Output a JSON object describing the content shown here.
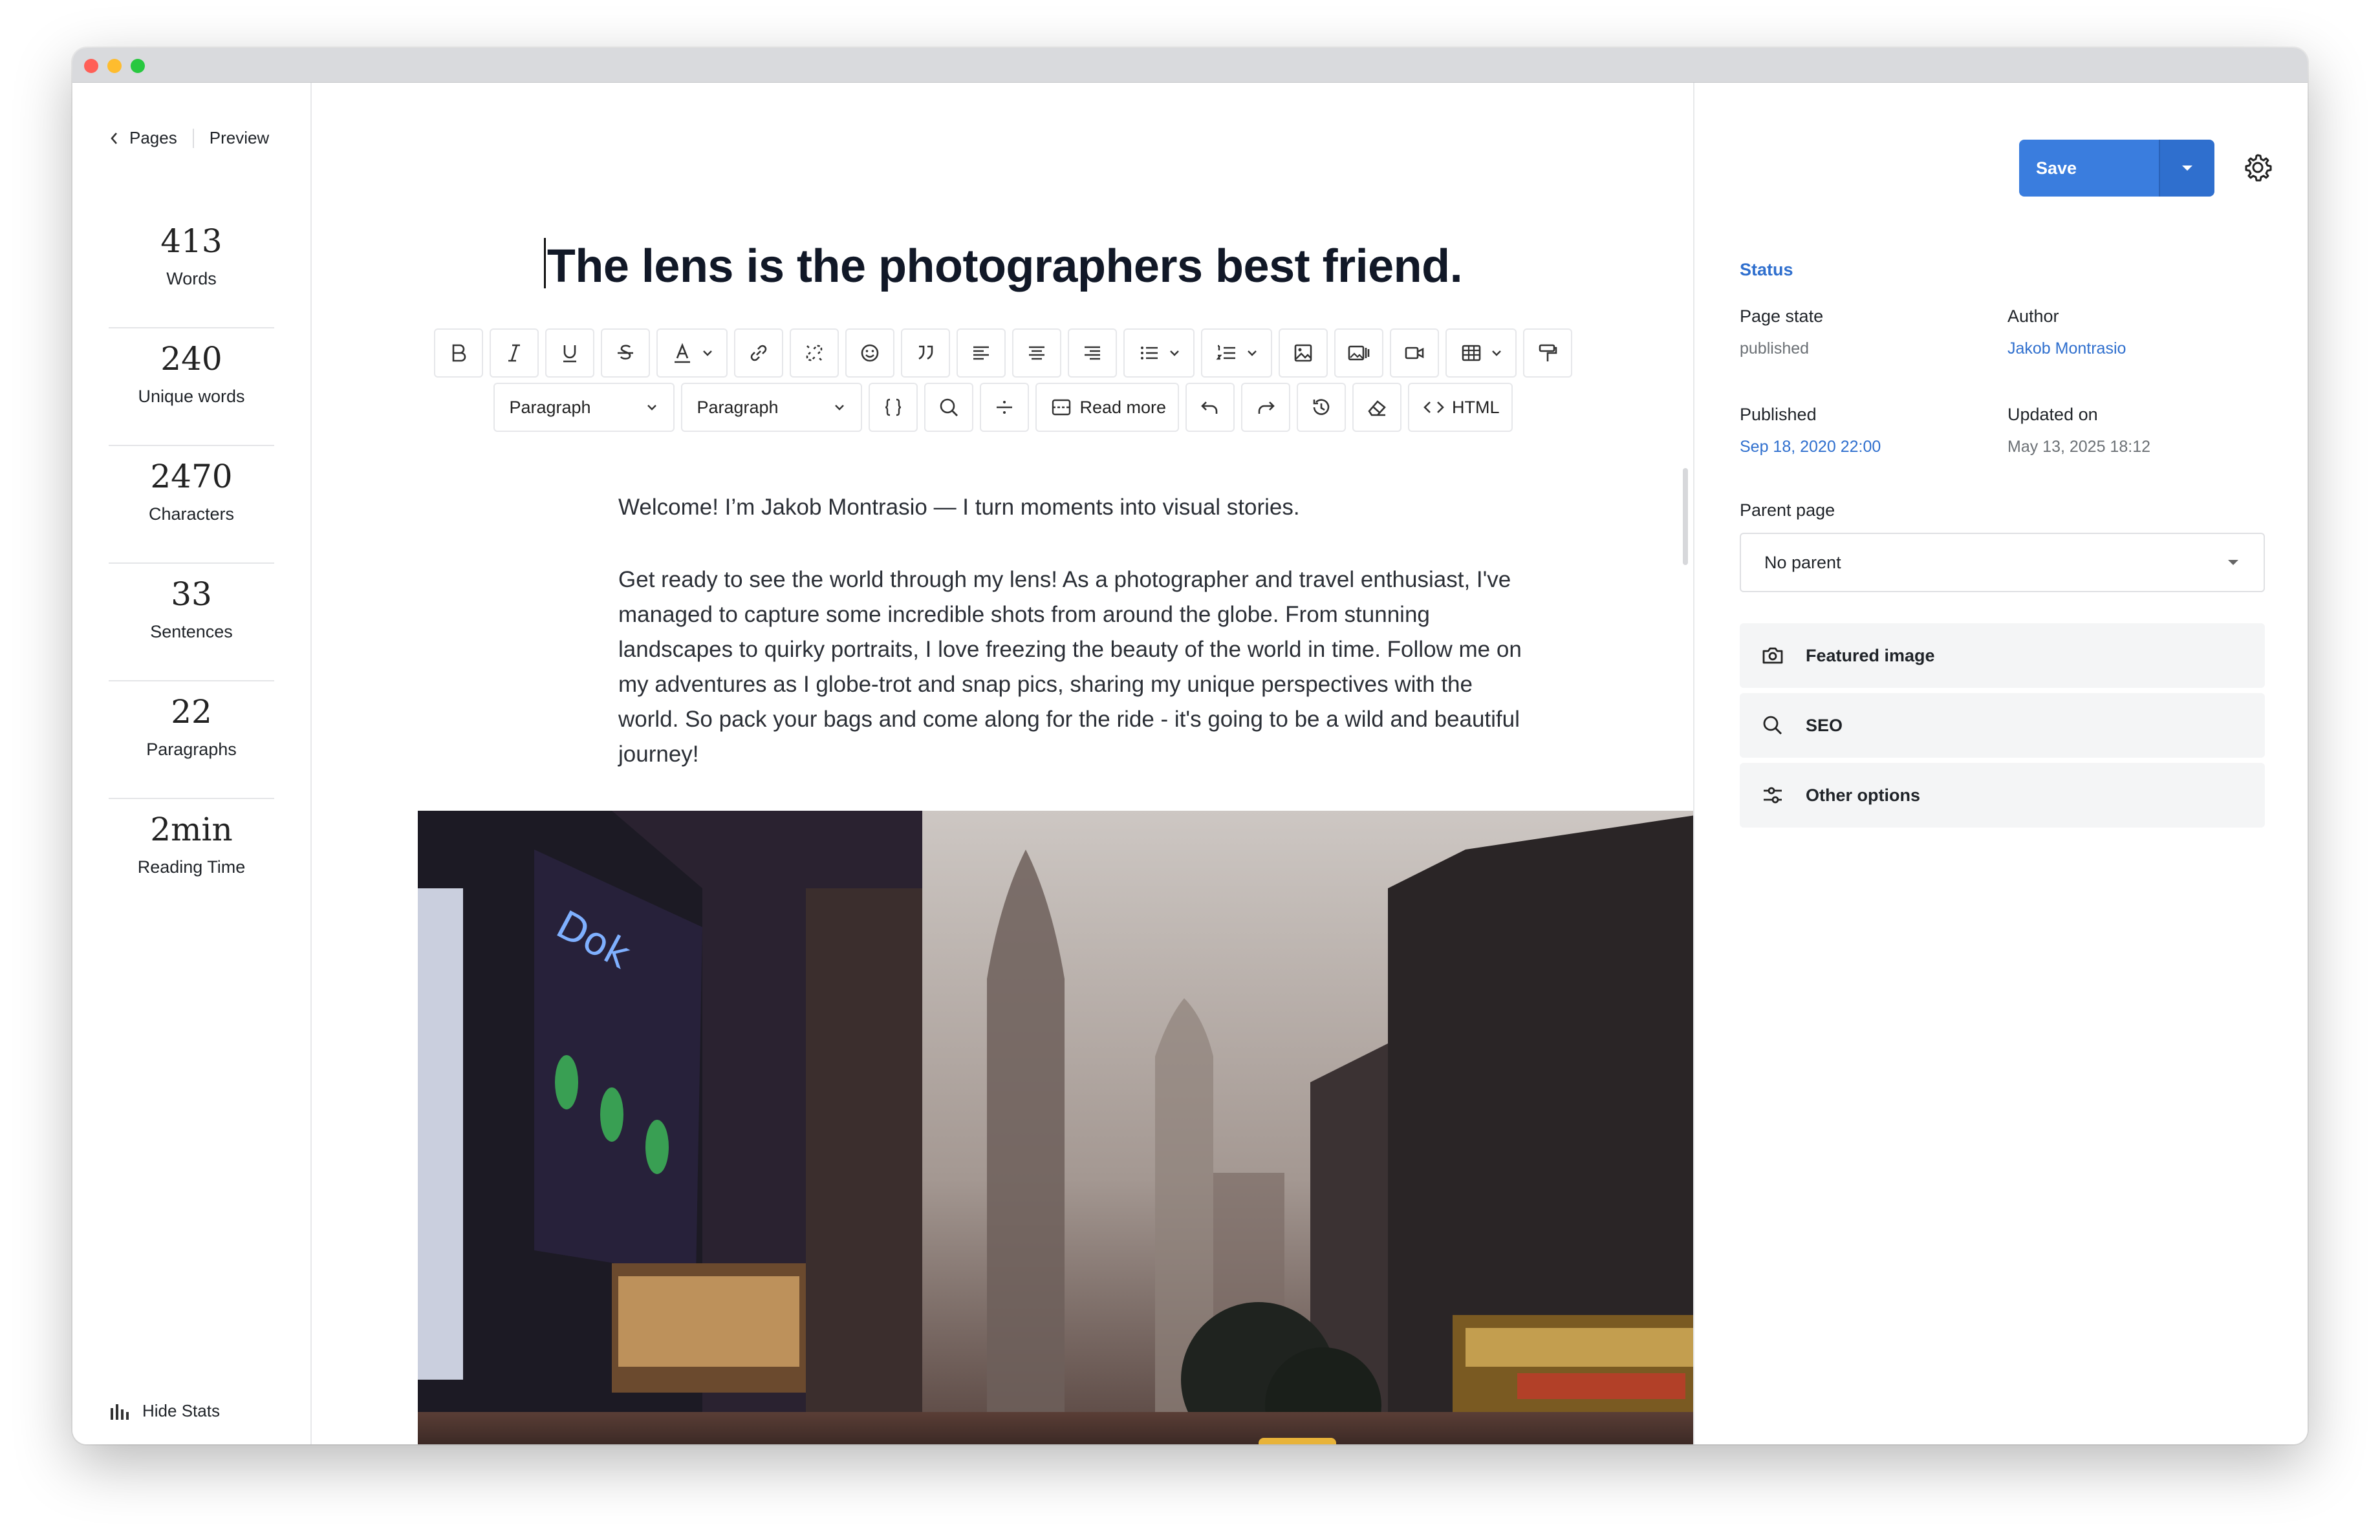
{
  "nav": {
    "back_label": "Pages",
    "preview_label": "Preview"
  },
  "stats": [
    {
      "value": "413",
      "label": "Words"
    },
    {
      "value": "240",
      "label": "Unique words"
    },
    {
      "value": "2470",
      "label": "Characters"
    },
    {
      "value": "33",
      "label": "Sentences"
    },
    {
      "value": "22",
      "label": "Paragraphs"
    },
    {
      "value": "2min",
      "label": "Reading Time"
    }
  ],
  "hide_stats_label": "Hide Stats",
  "document": {
    "title": "The lens is the photographers best friend.",
    "paragraphs": [
      "Welcome! I’m Jakob Montrasio — I turn moments into visual stories.",
      "Get ready to see the world through my lens! As a photographer and travel enthusiast, I've managed to capture some incredible shots from around the globe. From stunning landscapes to quirky portraits, I love freezing the beauty of the world in time. Follow me on my adventures as I globe-trot and snap pics, sharing my unique perspectives with the world. So pack your bags and come along for the ride - it's going to be a wild and beautiful journey!"
    ]
  },
  "toolbar": {
    "format_select_1": "Paragraph",
    "format_select_2": "Paragraph",
    "read_more_label": "Read more",
    "html_label": "HTML",
    "icons": [
      "bold-icon",
      "italic-icon",
      "underline-icon",
      "strikethrough-icon",
      "text-color-icon",
      "link-icon",
      "unlink-icon",
      "emoji-icon",
      "quote-icon",
      "align-left-icon",
      "align-center-icon",
      "align-right-icon",
      "bullet-list-icon",
      "numbered-list-icon",
      "image-icon",
      "gallery-icon",
      "video-icon",
      "table-icon",
      "format-painter-icon",
      "code-block-icon",
      "search-icon",
      "divider-icon",
      "read-more-icon",
      "undo-icon",
      "redo-icon",
      "history-icon",
      "eraser-icon",
      "html-icon"
    ]
  },
  "sidebar": {
    "save_label": "Save",
    "status_heading": "Status",
    "page_state_label": "Page state",
    "page_state_value": "published",
    "author_label": "Author",
    "author_value": "Jakob Montrasio",
    "published_label": "Published",
    "published_value": "Sep 18, 2020 22:00",
    "updated_label": "Updated on",
    "updated_value": "May 13, 2025 18:12",
    "parent_page_label": "Parent page",
    "parent_page_value": "No parent",
    "panels": [
      "Featured image",
      "SEO",
      "Other options"
    ]
  },
  "colors": {
    "accent": "#3a7dde",
    "link": "#2f6fce"
  }
}
